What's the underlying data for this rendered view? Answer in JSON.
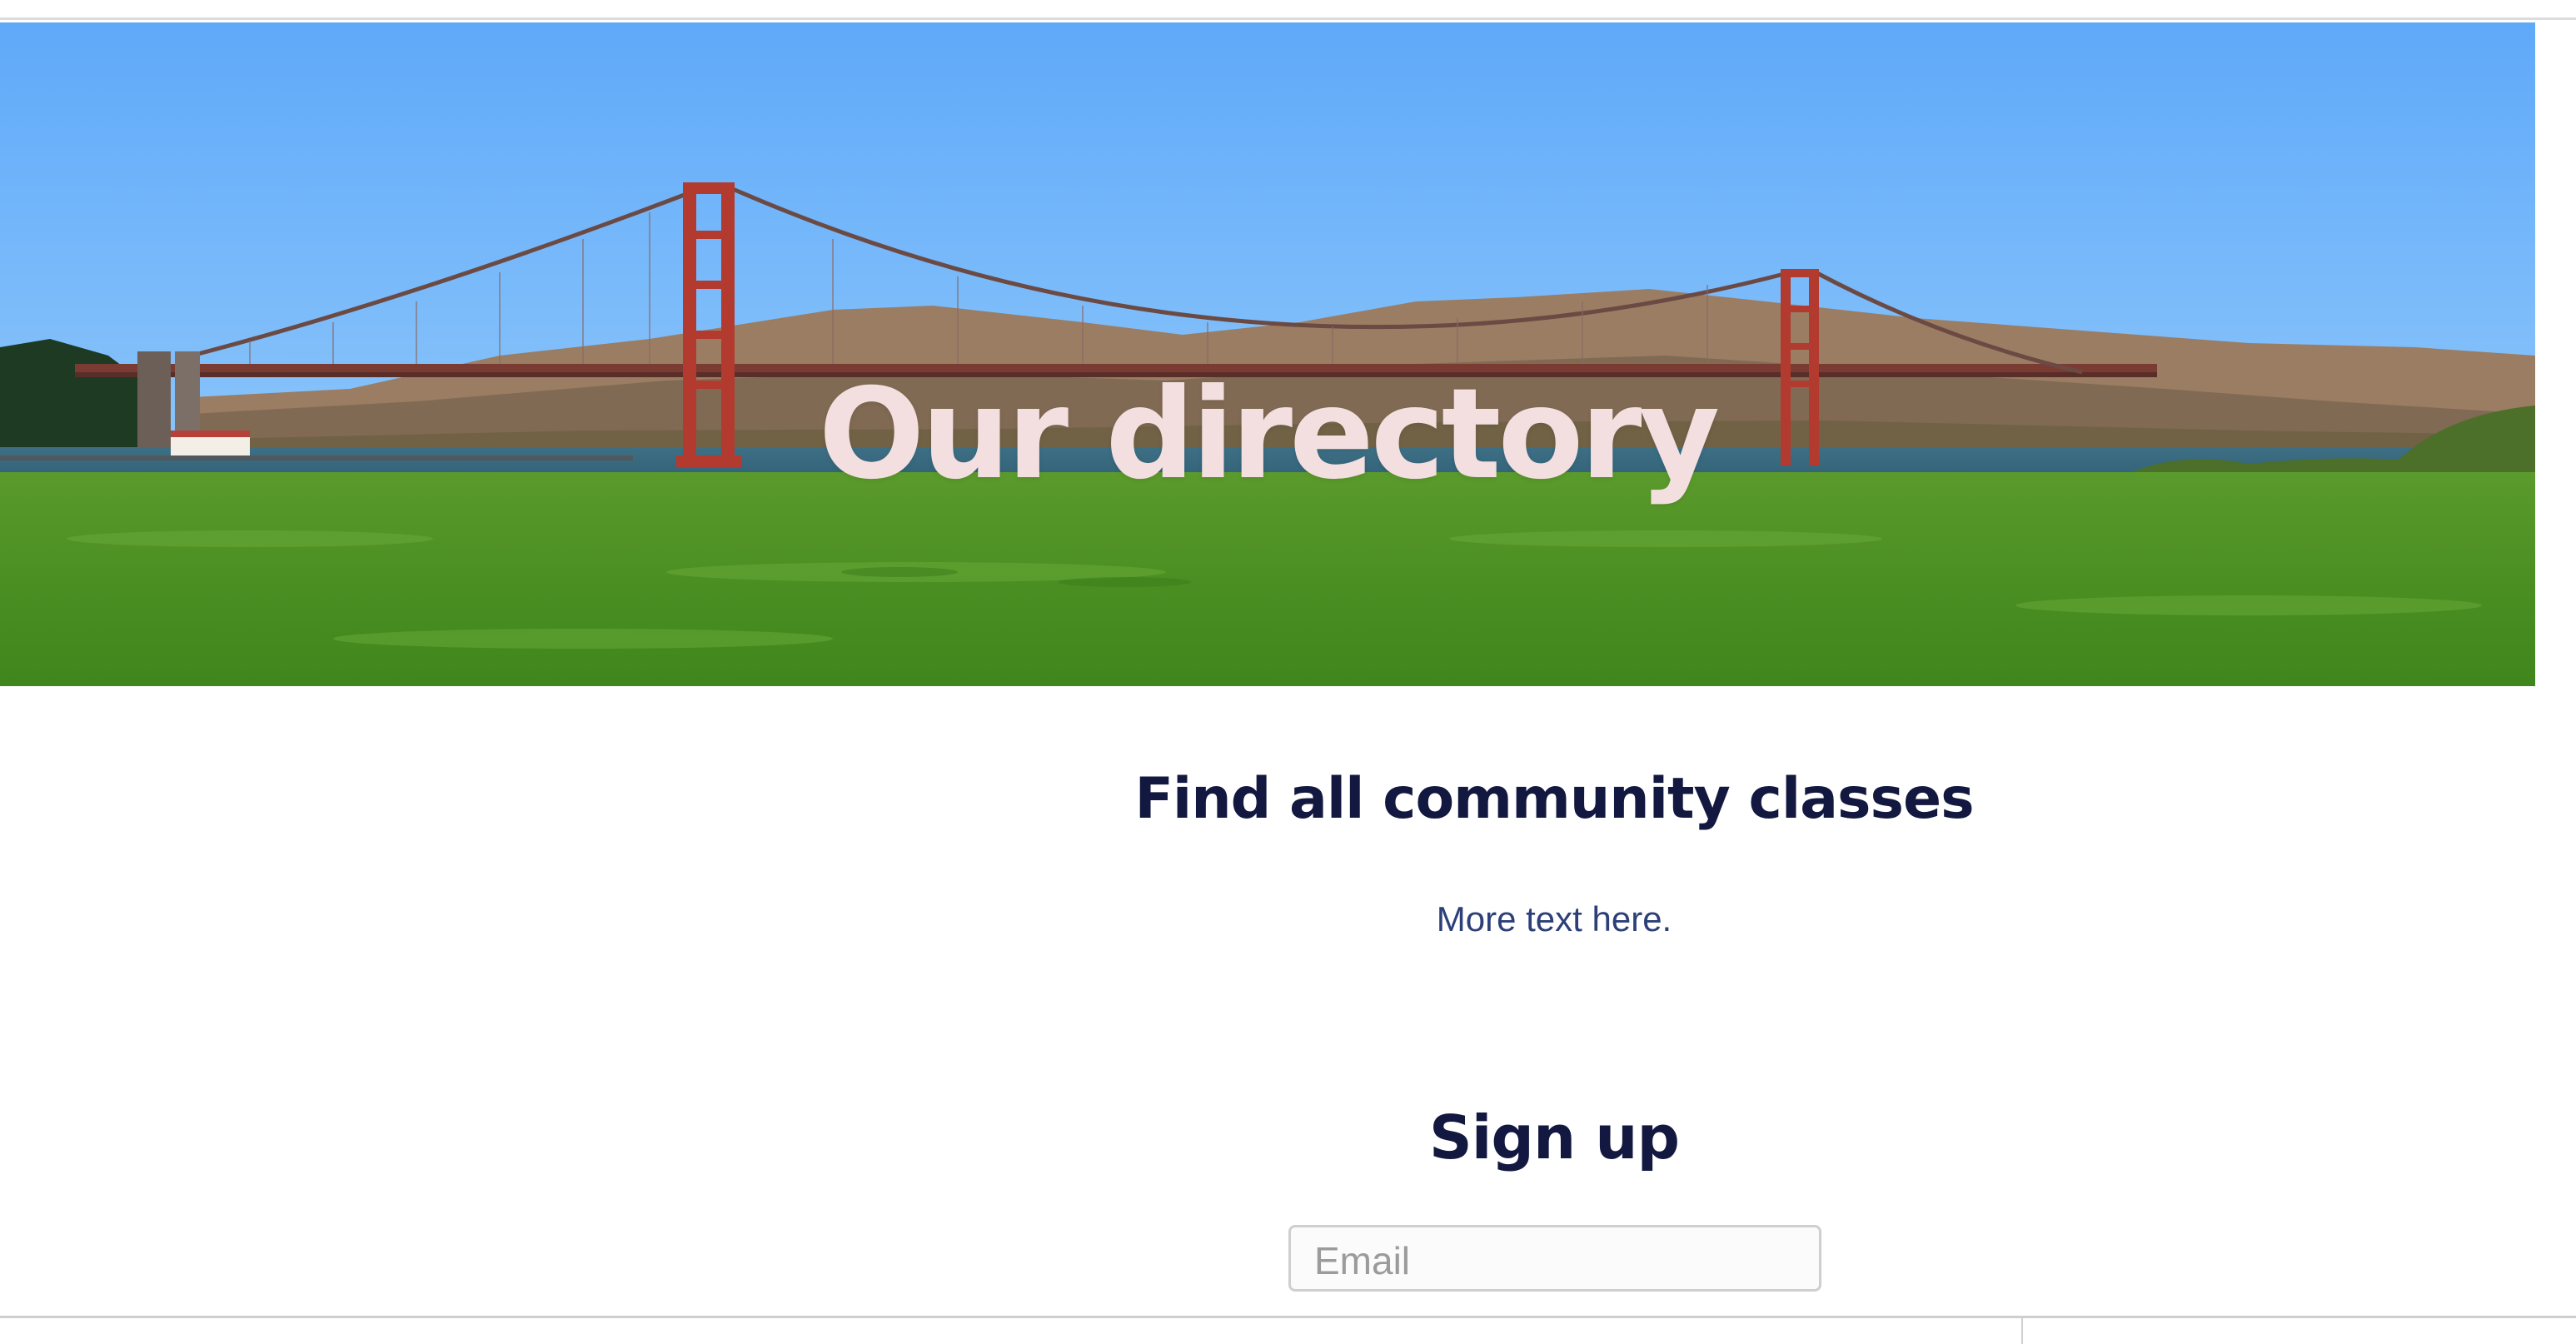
{
  "hero": {
    "title": "Our directory",
    "image_icon": "golden-gate-bridge-photo"
  },
  "classes": {
    "heading": "Find all community classes",
    "text": "More text here."
  },
  "signup": {
    "heading": "Sign up",
    "email_placeholder": "Email",
    "email_value": ""
  },
  "colors": {
    "heading": "#12183f",
    "body_text": "#2c3f78",
    "hero_title": "#f3dfe0",
    "bridge": "#b23a2e"
  }
}
